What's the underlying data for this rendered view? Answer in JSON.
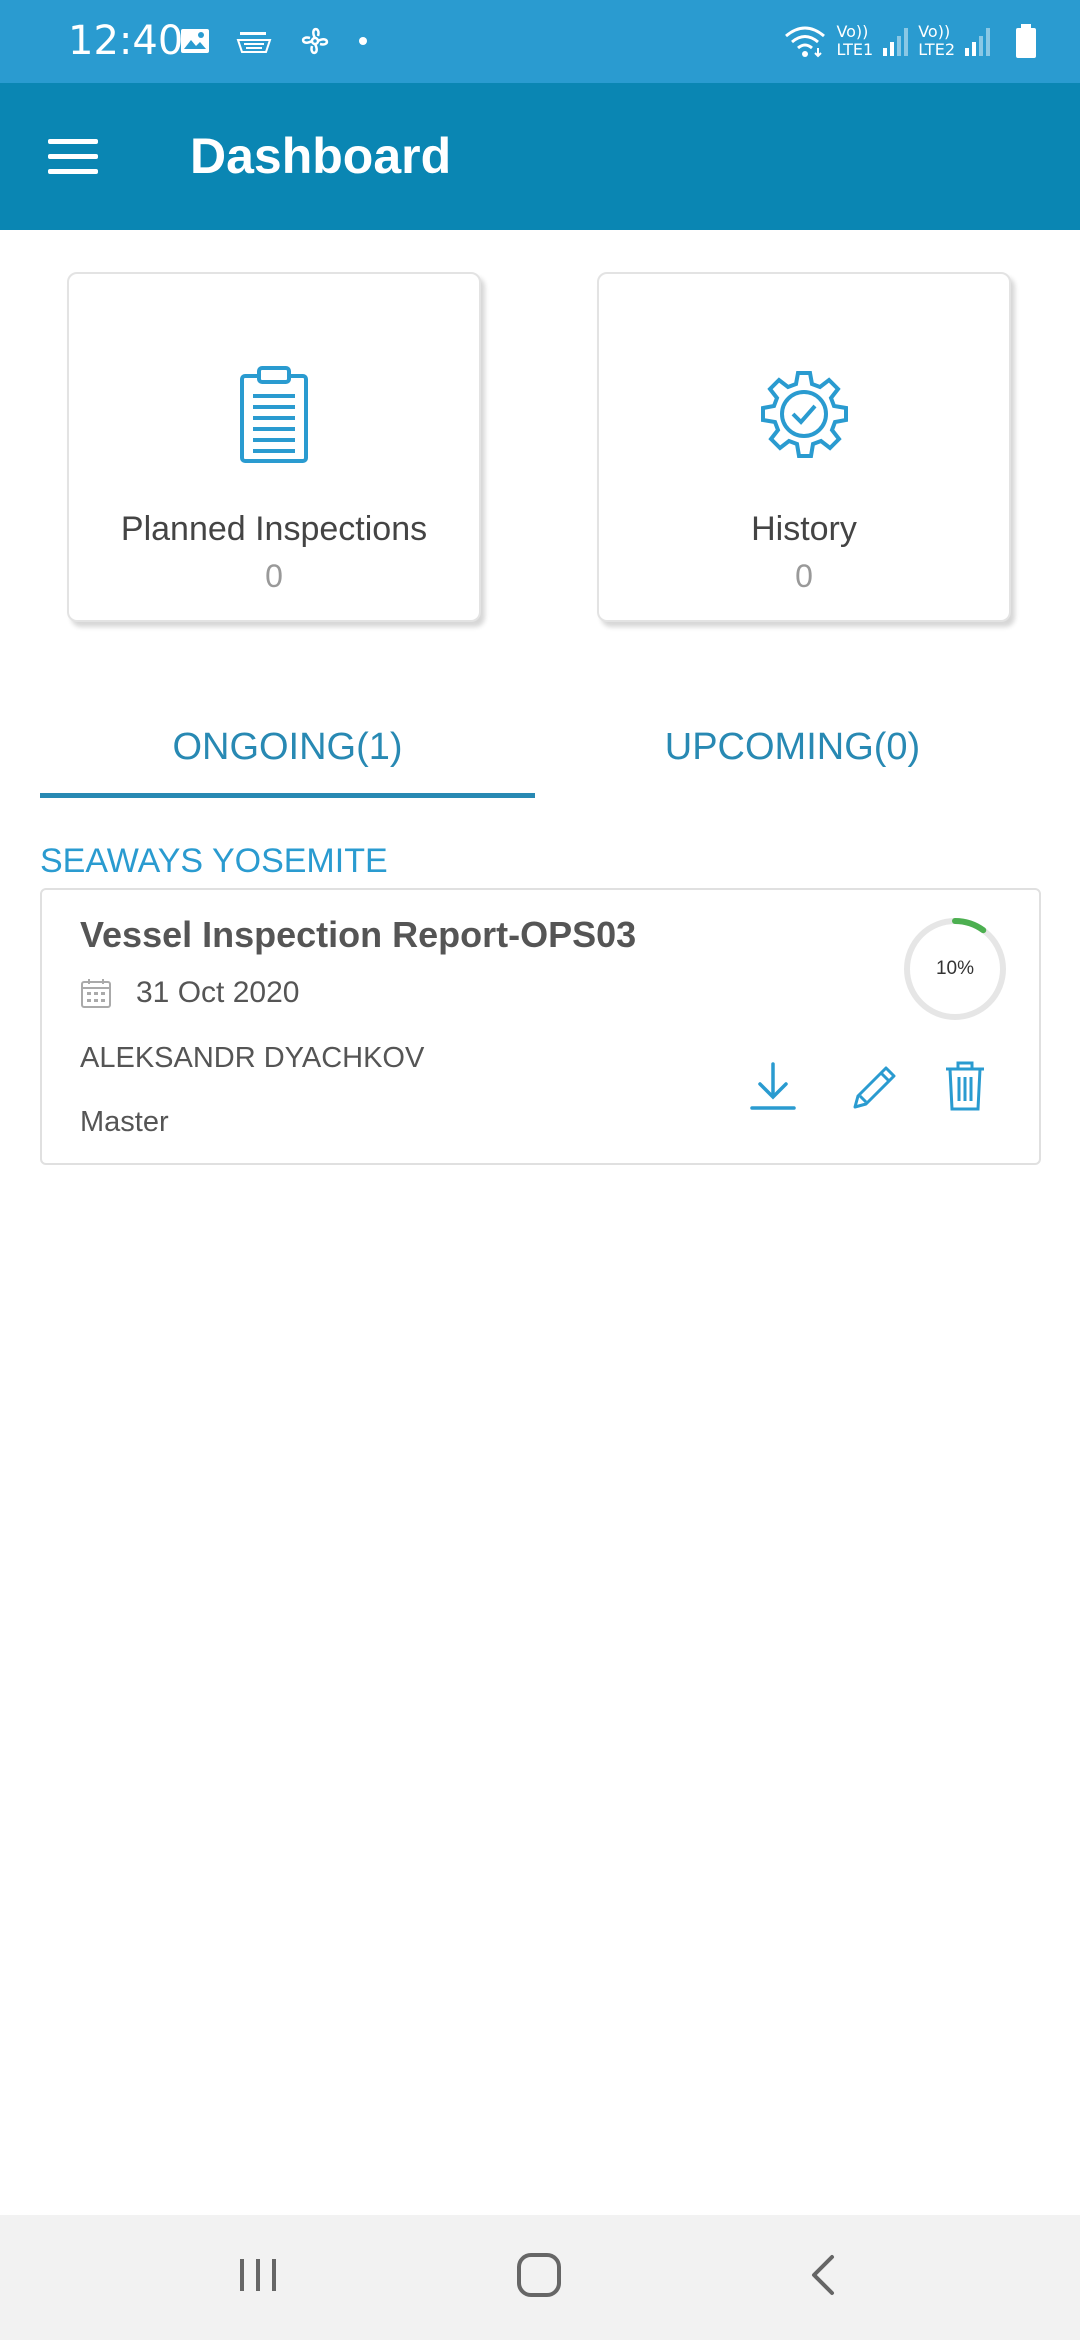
{
  "status_bar": {
    "time": "12:40",
    "left_icons": [
      "gallery-icon",
      "amazon-icon",
      "fan-icon",
      "dot-icon"
    ],
    "sim1": {
      "top": "Vo))",
      "bottom": "LTE1"
    },
    "sim2": {
      "top": "Vo))",
      "bottom": "LTE2"
    },
    "right_icons": [
      "wifi-icon",
      "signal-icon",
      "battery-icon"
    ]
  },
  "app_bar": {
    "title": "Dashboard",
    "menu_icon": "hamburger-icon"
  },
  "cards": {
    "planned": {
      "label": "Planned Inspections",
      "count": "0",
      "icon": "clipboard-icon"
    },
    "history": {
      "label": "History",
      "count": "0",
      "icon": "gear-check-icon"
    }
  },
  "tabs": {
    "ongoing": "ONGOING(1)",
    "upcoming": "UPCOMING(0)",
    "active": "ongoing"
  },
  "vessel": {
    "name": "SEAWAYS YOSEMITE"
  },
  "inspection": {
    "title": "Vessel Inspection Report-OPS03",
    "date": "31 Oct 2020",
    "person": "ALEKSANDR DYACHKOV",
    "role": "Master",
    "progress_label": "10%",
    "progress_fraction": 0.1,
    "actions": [
      "download-icon",
      "edit-icon",
      "delete-icon"
    ]
  },
  "colors": {
    "status_bar": "#2a9bd0",
    "app_bar": "#0a86b3",
    "accent": "#2889b3",
    "progress": "#4caf50"
  },
  "bottom_nav": [
    "recent-apps-icon",
    "home-icon",
    "back-icon"
  ]
}
